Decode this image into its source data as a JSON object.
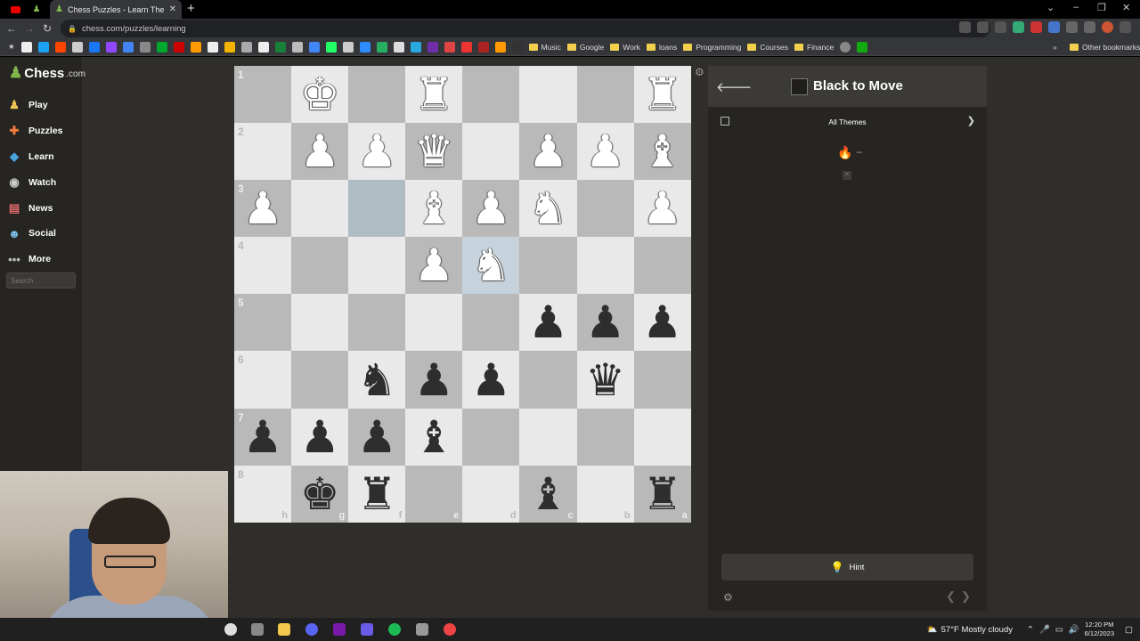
{
  "browser": {
    "tab_title": "Chess Puzzles - Learn Themes an",
    "url": "chess.com/puzzles/learning",
    "bookmarks": [
      "Music",
      "Google",
      "Work",
      "loans",
      "Programming",
      "Courses",
      "Finance"
    ],
    "bookmarks_overflow": "»",
    "other_bookmarks": "Other bookmarks"
  },
  "site": {
    "logo_text": "Chess",
    "logo_domain": ".com",
    "nav": [
      {
        "label": "Play",
        "icon": "play-icon",
        "glyph": "♟",
        "color": "#f0c452"
      },
      {
        "label": "Puzzles",
        "icon": "puzzle-icon",
        "glyph": "✚",
        "color": "#ef7b3c"
      },
      {
        "label": "Learn",
        "icon": "learn-icon",
        "glyph": "◆",
        "color": "#4aa3df"
      },
      {
        "label": "Watch",
        "icon": "watch-icon",
        "glyph": "◉",
        "color": "#cccccc"
      },
      {
        "label": "News",
        "icon": "news-icon",
        "glyph": "▤",
        "color": "#e06a6a"
      },
      {
        "label": "Social",
        "icon": "social-icon",
        "glyph": "☻",
        "color": "#7cc0e8"
      },
      {
        "label": "More",
        "icon": "more-icon",
        "glyph": "•••",
        "color": "#bbbbbb"
      }
    ],
    "search_placeholder": "Search"
  },
  "board": {
    "orientation": "black",
    "highlight_squares": [
      "f3",
      "d4"
    ],
    "ranks": [
      "1",
      "2",
      "3",
      "4",
      "5",
      "6",
      "7",
      "8"
    ],
    "files": [
      "h",
      "g",
      "f",
      "e",
      "d",
      "c",
      "b",
      "a"
    ],
    "pieces": [
      [
        "",
        "wK",
        "",
        "wR",
        "",
        "",
        "",
        "wR"
      ],
      [
        "",
        "wP",
        "wP",
        "wQ",
        "",
        "wP",
        "wP",
        "wB"
      ],
      [
        "wP",
        "",
        "",
        "wB",
        "wP",
        "wN",
        "",
        "wP"
      ],
      [
        "",
        "",
        "",
        "wP",
        "wN",
        "",
        "",
        ""
      ],
      [
        "",
        "",
        "",
        "",
        "",
        "bP",
        "bP",
        "bP"
      ],
      [
        "",
        "",
        "bN",
        "bP",
        "bP",
        "",
        "bQ",
        ""
      ],
      [
        "bP",
        "bP",
        "bP",
        "bB",
        "",
        "",
        "",
        ""
      ],
      [
        "",
        "bK",
        "bR",
        "",
        "",
        "bB",
        "",
        "bR"
      ]
    ]
  },
  "panel": {
    "turn_label": "Black to Move",
    "themes_label": "All Themes",
    "streak_value": "--",
    "hint_label": "Hint"
  },
  "taskbar": {
    "weather": "57°F  Mostly cloudy",
    "time": "12:20 PM",
    "date": "6/12/2023"
  }
}
